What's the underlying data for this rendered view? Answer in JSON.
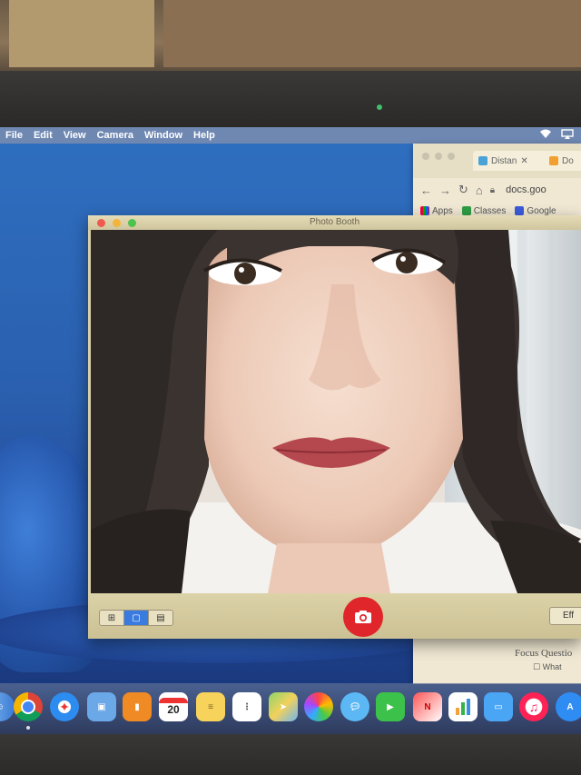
{
  "menubar": {
    "items": [
      "File",
      "Edit",
      "View",
      "Camera",
      "Window",
      "Help"
    ]
  },
  "photo_booth": {
    "title": "Photo Booth",
    "view_modes": [
      "grid",
      "single",
      "filmstrip"
    ],
    "effects_label": "Eff"
  },
  "chrome": {
    "tab1": "Distan",
    "tab2": "Do",
    "omnibox": "docs.goo",
    "bookmarks": [
      "Apps",
      "Classes",
      "Google"
    ]
  },
  "doc": {
    "heading": "Focus Questio",
    "line": "What"
  },
  "dock": {
    "calendar_day": "20",
    "apps": [
      "finder",
      "chrome",
      "safari",
      "preview",
      "books",
      "calendar",
      "notes",
      "reminders",
      "maps",
      "photos",
      "messages",
      "facetime",
      "news",
      "numbers",
      "keynote",
      "music",
      "app-store"
    ]
  }
}
